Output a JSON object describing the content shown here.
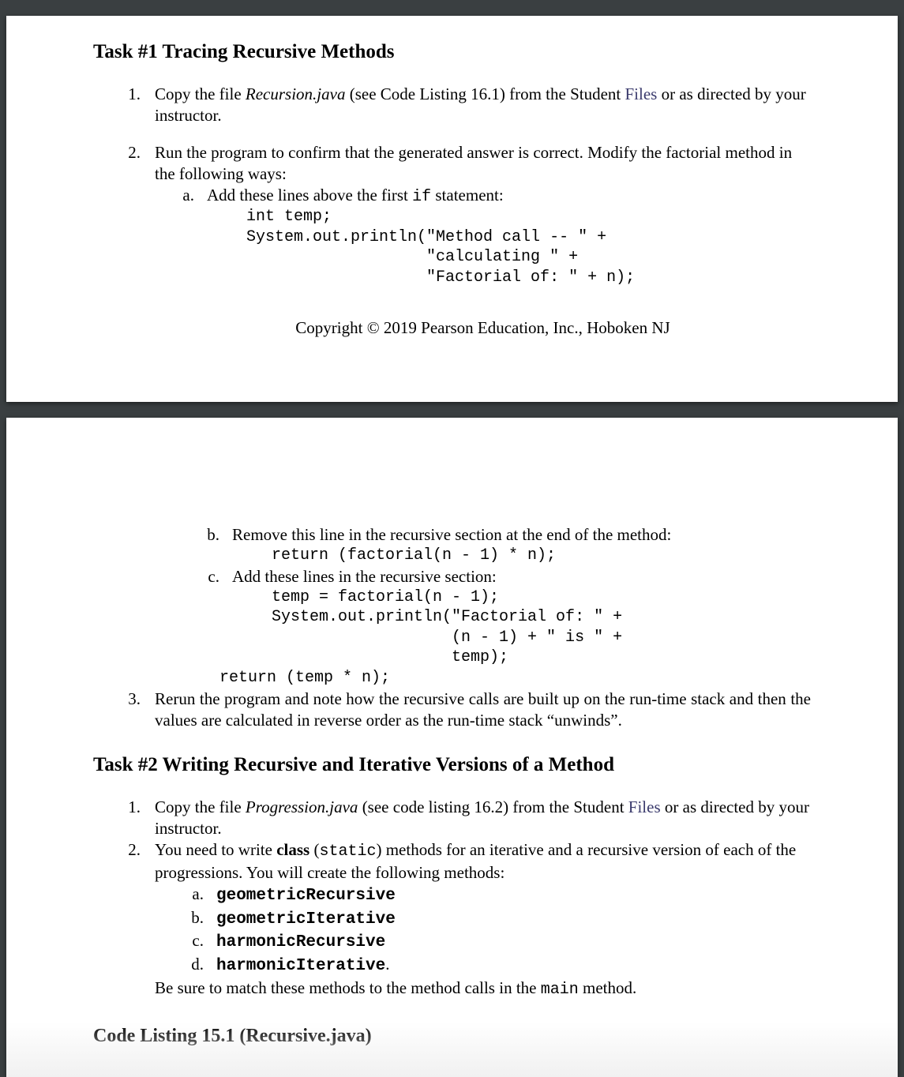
{
  "page1": {
    "task1_title": "Task #1 Tracing Recursive Methods",
    "item1_num": "1.",
    "item1_pre": "Copy the file ",
    "item1_file": "Recursion.java",
    "item1_mid": " (see Code Listing 16.1) from the Student ",
    "item1_files_link": "Files",
    "item1_post": " or as directed by your instructor.",
    "item2_num": "2.",
    "item2_text": "Run the program to confirm that the generated answer is correct. Modify the factorial method in the following ways:",
    "item2a_letter": "a.",
    "item2a_pre": "Add these lines above the first ",
    "item2a_code_inline": "if",
    "item2a_post": " statement:",
    "code_a": "int temp;\nSystem.out.println(\"Method call -- \" +\n                   \"calculating \" +\n                   \"Factorial of: \" + n);",
    "copyright": "Copyright © 2019 Pearson Education, Inc., Hoboken NJ"
  },
  "page2": {
    "item2b_letter": "b.",
    "item2b_text": "Remove this line in the recursive section at the end of the method:",
    "code_b": "return (factorial(n - 1) * n);",
    "item2c_letter": "c.",
    "item2c_text": "Add these lines in the recursive section:",
    "code_c": "temp = factorial(n - 1);\nSystem.out.println(\"Factorial of: \" +\n                   (n - 1) + \" is \" +\n                   temp);",
    "code_c_return": "return (temp * n);",
    "item3_num": "3.",
    "item3_text": "Rerun the program and note how the recursive calls are built up on the run-time stack and then the values are calculated in reverse order as the run-time stack “unwinds”.",
    "task2_title": "Task #2 Writing Recursive and Iterative Versions of a Method",
    "t2_item1_num": "1.",
    "t2_item1_pre": "Copy the file ",
    "t2_item1_file": "Progression.java",
    "t2_item1_mid": " (see code listing 16.2) from the Student ",
    "t2_item1_files_link": "Files",
    "t2_item1_post": " or as directed by your instructor.",
    "t2_item2_num": "2.",
    "t2_item2_pre": "You need to write ",
    "t2_item2_bold": "class",
    "t2_item2_mid1": " (",
    "t2_item2_static": "static",
    "t2_item2_mid2": ") methods for an iterative and a recursive version of each of the progressions. You will create the following methods:",
    "m_a_letter": "a.",
    "m_a": "geometricRecursive",
    "m_b_letter": "b.",
    "m_b": "geometricIterative",
    "m_c_letter": "c.",
    "m_c": "harmonicRecursive",
    "m_d_letter": "d.",
    "m_d": "harmonicIterative",
    "m_d_dot": ".",
    "t2_item2_tail_pre": "Be sure to match these methods to the method calls in the ",
    "t2_item2_tail_code": "main",
    "t2_item2_tail_post": " method.",
    "cutoff": "Code Listing 15.1 (Recursive.java)"
  }
}
